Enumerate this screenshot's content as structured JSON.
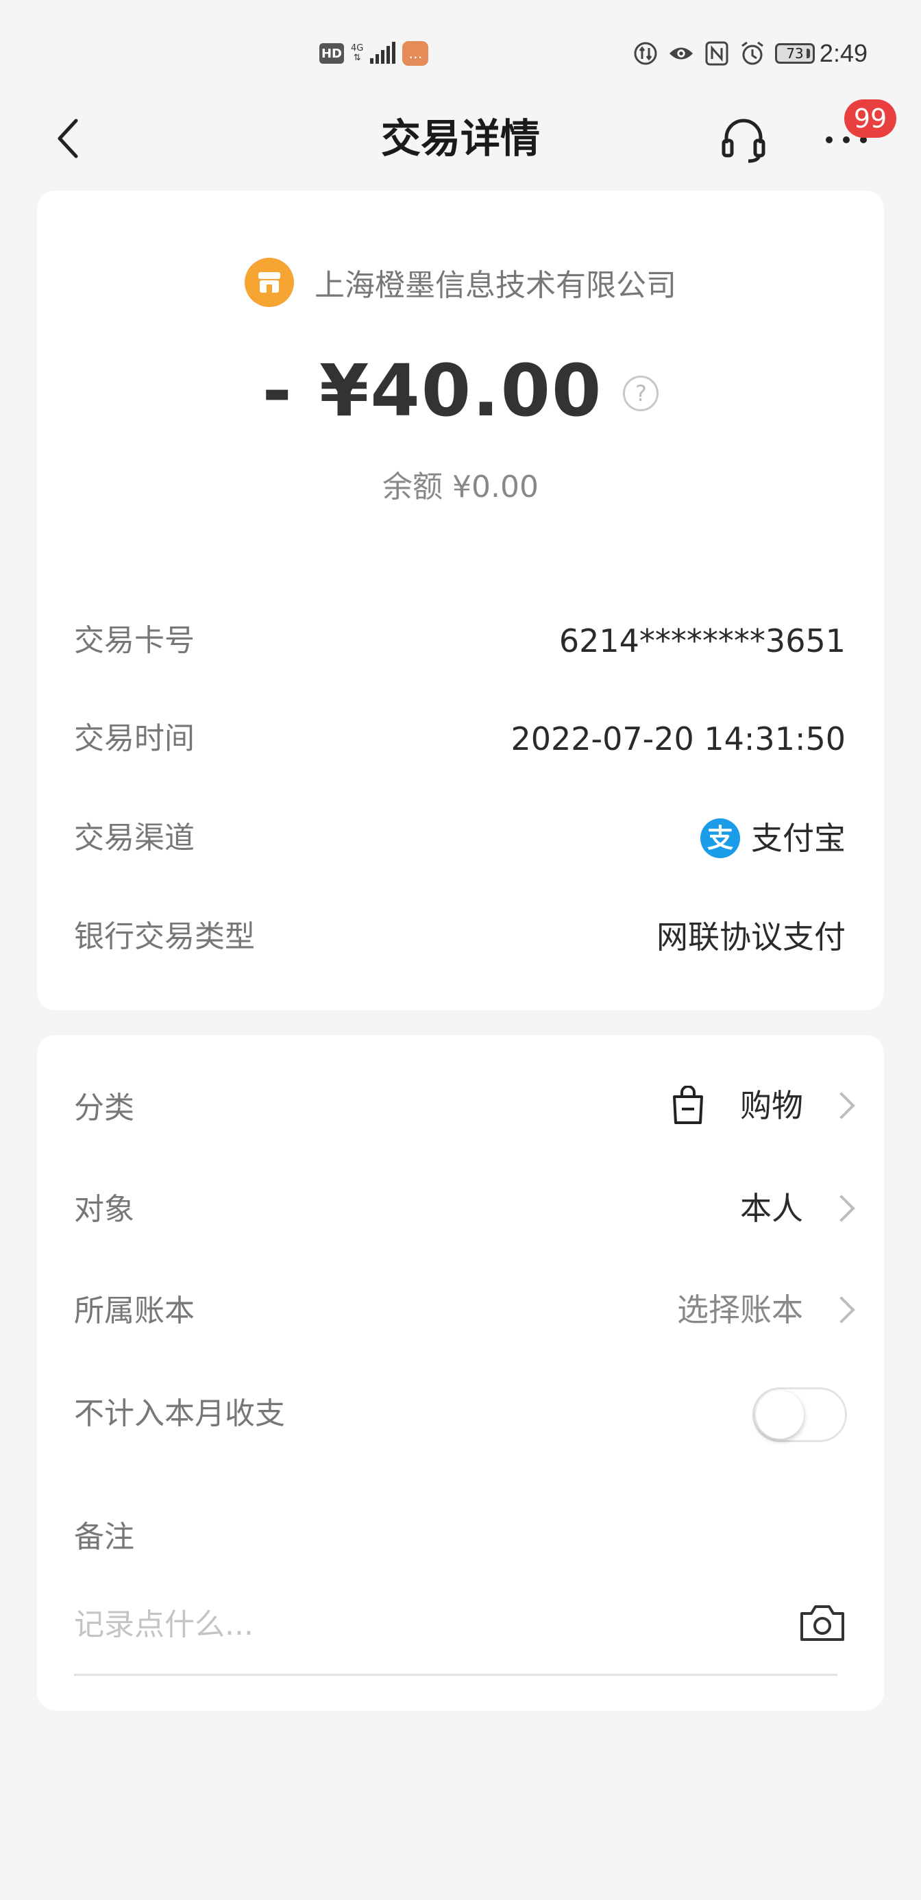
{
  "status_bar": {
    "hd": "HD",
    "network": "4G",
    "battery": "73",
    "time": "2:49"
  },
  "header": {
    "title": "交易详情",
    "badge": "99"
  },
  "transaction": {
    "merchant": "上海橙墨信息技术有限公司",
    "amount": "- ¥40.00",
    "balance": "余额 ¥0.00"
  },
  "details": [
    {
      "label": "交易卡号",
      "value": "6214********3651"
    },
    {
      "label": "交易时间",
      "value": "2022-07-20 14:31:50"
    },
    {
      "label": "交易渠道",
      "value": "支付宝"
    },
    {
      "label": "银行交易类型",
      "value": "网联协议支付"
    }
  ],
  "settings": {
    "category": {
      "label": "分类",
      "value": "购物"
    },
    "target": {
      "label": "对象",
      "value": "本人"
    },
    "ledger": {
      "label": "所属账本",
      "value": "选择账本"
    },
    "exclude": {
      "label": "不计入本月收支",
      "enabled": false
    },
    "note": {
      "label": "备注",
      "placeholder": "记录点什么..."
    }
  },
  "colors": {
    "background": "#f5f5f5",
    "card": "#ffffff",
    "badge": "#ea3f3f",
    "merchant_icon": "#f6a533",
    "alipay": "#1a9ce9"
  }
}
